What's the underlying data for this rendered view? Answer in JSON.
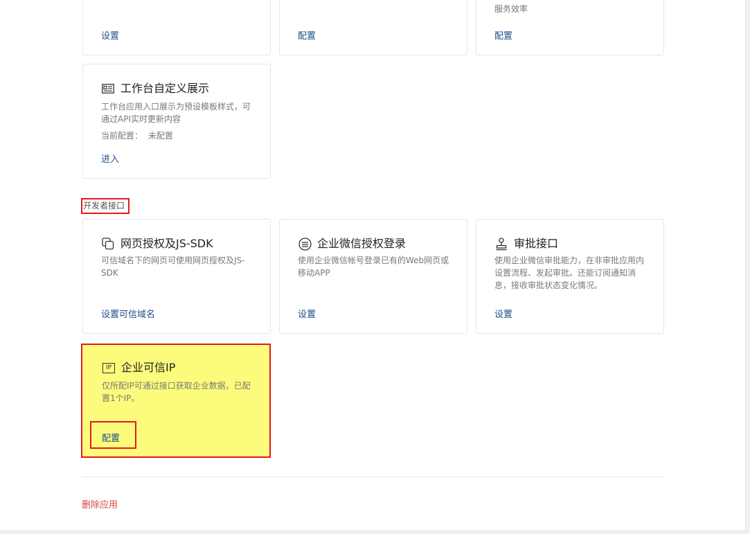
{
  "top_cards": [
    {
      "desc": "",
      "link": "设置"
    },
    {
      "desc": "",
      "link": "配置"
    },
    {
      "desc": "服务效率",
      "link": "配置"
    }
  ],
  "workbench_card": {
    "title": "工作台自定义展示",
    "desc": "工作台应用入口展示为预设模板样式，可通过API实时更新内容",
    "config_label": "当前配置：",
    "config_value": "未配置",
    "link": "进入",
    "icon": "template-icon"
  },
  "section": {
    "label": "开发者接口"
  },
  "dev_cards": [
    {
      "title": "网页授权及JS-SDK",
      "desc": "可信域名下的网页可使用网页授权及JS-SDK",
      "link": "设置可信域名",
      "icon": "pages-icon"
    },
    {
      "title": "企业微信授权登录",
      "desc": "使用企业微信帐号登录已有的Web网页或移动APP",
      "link": "设置",
      "icon": "menu-circle-icon"
    },
    {
      "title": "审批接口",
      "desc": "使用企业微信审批能力，在非审批应用内设置流程、发起审批。还能订阅通知消息，接收审批状态变化情况。",
      "link": "设置",
      "icon": "stamp-icon"
    }
  ],
  "trusted_ip_card": {
    "title": "企业可信IP",
    "icon_text": "IP",
    "desc": "仅所配IP可通过接口获取企业数据，已配置1个IP。",
    "link": "配置"
  },
  "footer": {
    "delete_label": "删除应用"
  },
  "colors": {
    "link": "#1d4e89",
    "danger": "#d9433d",
    "highlight": "#fdfb7c",
    "annotation_border": "#e01b1b"
  }
}
